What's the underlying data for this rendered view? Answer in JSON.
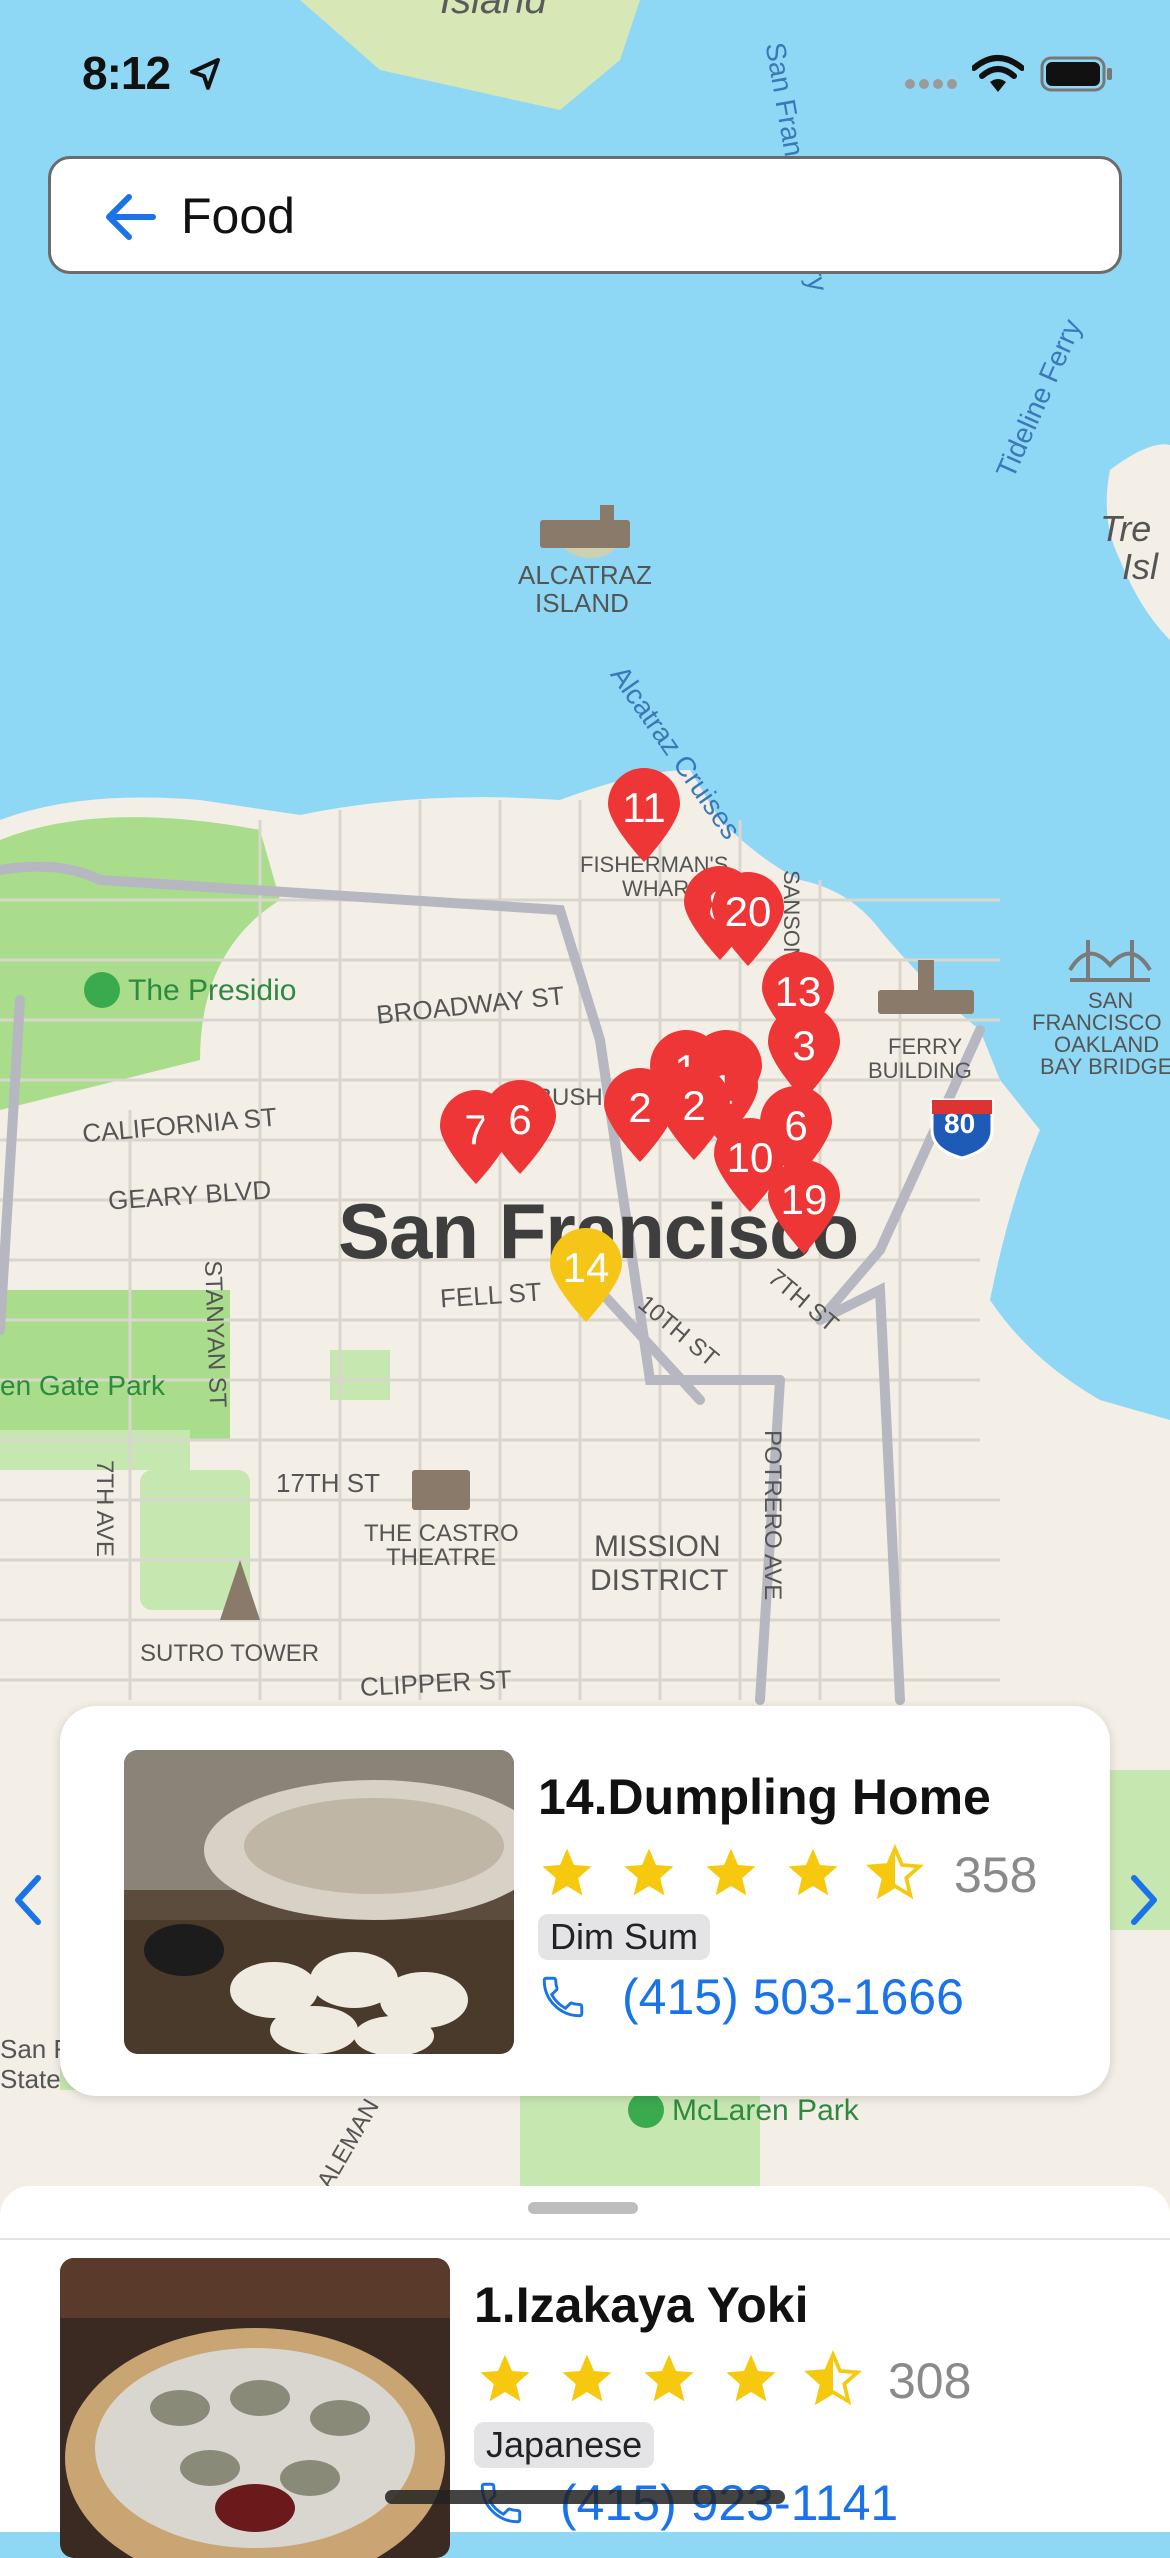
{
  "status_bar": {
    "time": "8:12"
  },
  "search": {
    "query": "Food"
  },
  "map": {
    "labels": {
      "island": "Island",
      "alcatraz_1": "ALCATRAZ",
      "alcatraz_2": "ISLAND",
      "alcatraz_cruises": "Alcatraz Cruises",
      "tideline_ferry": "Tideline Ferry",
      "sf_ferry": "San Francisco Ferry",
      "treasure_1": "Tre",
      "treasure_2": "Isl",
      "fishermans_1": "FISHERMAN'S",
      "fishermans_2": "WHARF",
      "presidio": "The Presidio",
      "broadway": "BROADWAY ST",
      "california": "CALIFORNIA ST",
      "geary": "GEARY BLVD",
      "bush": "BUSH",
      "sansome": "SANSOME ST",
      "ferry_bldg_1": "FERRY",
      "ferry_bldg_2": "BUILDING",
      "bay_bridge_1": "SAN",
      "bay_bridge_2": "FRANCISCO",
      "bay_bridge_3": "OAKLAND",
      "bay_bridge_4": "BAY BRIDGE",
      "interstate": "80",
      "city": "San Francisco",
      "fell": "FELL ST",
      "tenth": "10TH ST",
      "seventh": "7TH ST",
      "stanyan": "STANYAN ST",
      "golden_gate_park": "en Gate Park",
      "seventeenth": "17TH ST",
      "castro_1": "THE CASTRO",
      "castro_2": "THEATRE",
      "mission_1": "MISSION",
      "mission_2": "DISTRICT",
      "potrero": "POTRERO AVE",
      "seventh_ave": "7TH AVE",
      "sutro": "SUTRO TOWER",
      "clipper": "CLIPPER ST",
      "sf_state_1": "San F",
      "sf_state_2": "State",
      "mclaren": "McLaren Park",
      "alemany": "ALEMAN"
    },
    "pins": [
      "11",
      "8",
      "20",
      "13",
      "3",
      "1",
      "1",
      "2",
      "1",
      "2",
      "6",
      "10",
      "19",
      "7",
      "6",
      "14"
    ]
  },
  "selected_card": {
    "title": "14.Dumpling Home",
    "rating": 4.5,
    "review_count": "358",
    "category": "Dim Sum",
    "phone": "(415) 503-1666"
  },
  "list": {
    "items": [
      {
        "title": "1.Izakaya Yoki",
        "rating": 4.5,
        "review_count": "308",
        "category": "Japanese",
        "phone": "(415) 923-1141"
      }
    ]
  },
  "colors": {
    "water": "#8fd8f5",
    "land": "#f3efe6",
    "park": "#a9dc8b",
    "pin_red": "#ee3636",
    "pin_selected": "#f5c518",
    "star": "#f6c90e",
    "link_blue": "#1a73e8"
  }
}
